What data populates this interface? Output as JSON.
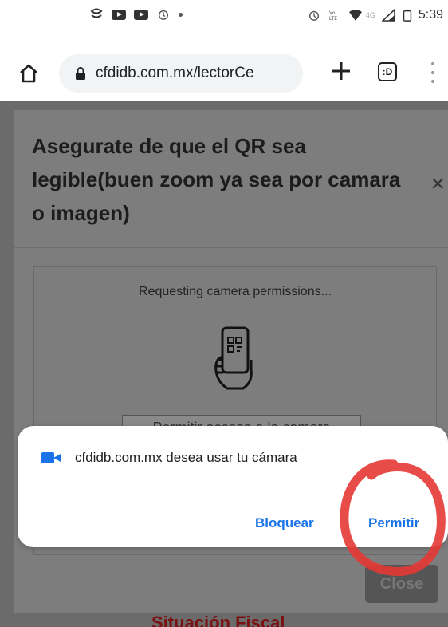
{
  "status_bar": {
    "time": "5:39",
    "network": "4G",
    "left_icons": [
      "chat-bubble-icon",
      "youtube-icon",
      "youtube-icon",
      "alarm-icon",
      "dot-icon"
    ],
    "right_icons": [
      "alarm-icon",
      "volte-icon",
      "wifi-icon",
      "signal-icon",
      "battery-icon"
    ]
  },
  "browser": {
    "url": "cfdidb.com.mx/lectorCe",
    "home_icon": "home-icon",
    "lock_icon": "lock-icon",
    "new_tab_icon": "plus-icon",
    "tabs_count": ":D",
    "menu_icon": "more-vertical-icon"
  },
  "modal": {
    "title": "Asegurate de que el QR sea legible(buen zoom ya sea por camara o imagen)",
    "close_glyph": "×",
    "scan_status": "Requesting camera permissions...",
    "permission_button_label": "Permitir acceso a la camara",
    "close_button_label": "Close"
  },
  "behind_text": "Situación Fiscal",
  "permission_dialog": {
    "message": "cfdidb.com.mx desea usar tu cámara",
    "block_label": "Bloquear",
    "allow_label": "Permitir",
    "icon": "camera-icon"
  },
  "colors": {
    "accent": "#1a73e8",
    "annotation": "#e53935",
    "overlay": "#7d7d7d"
  }
}
